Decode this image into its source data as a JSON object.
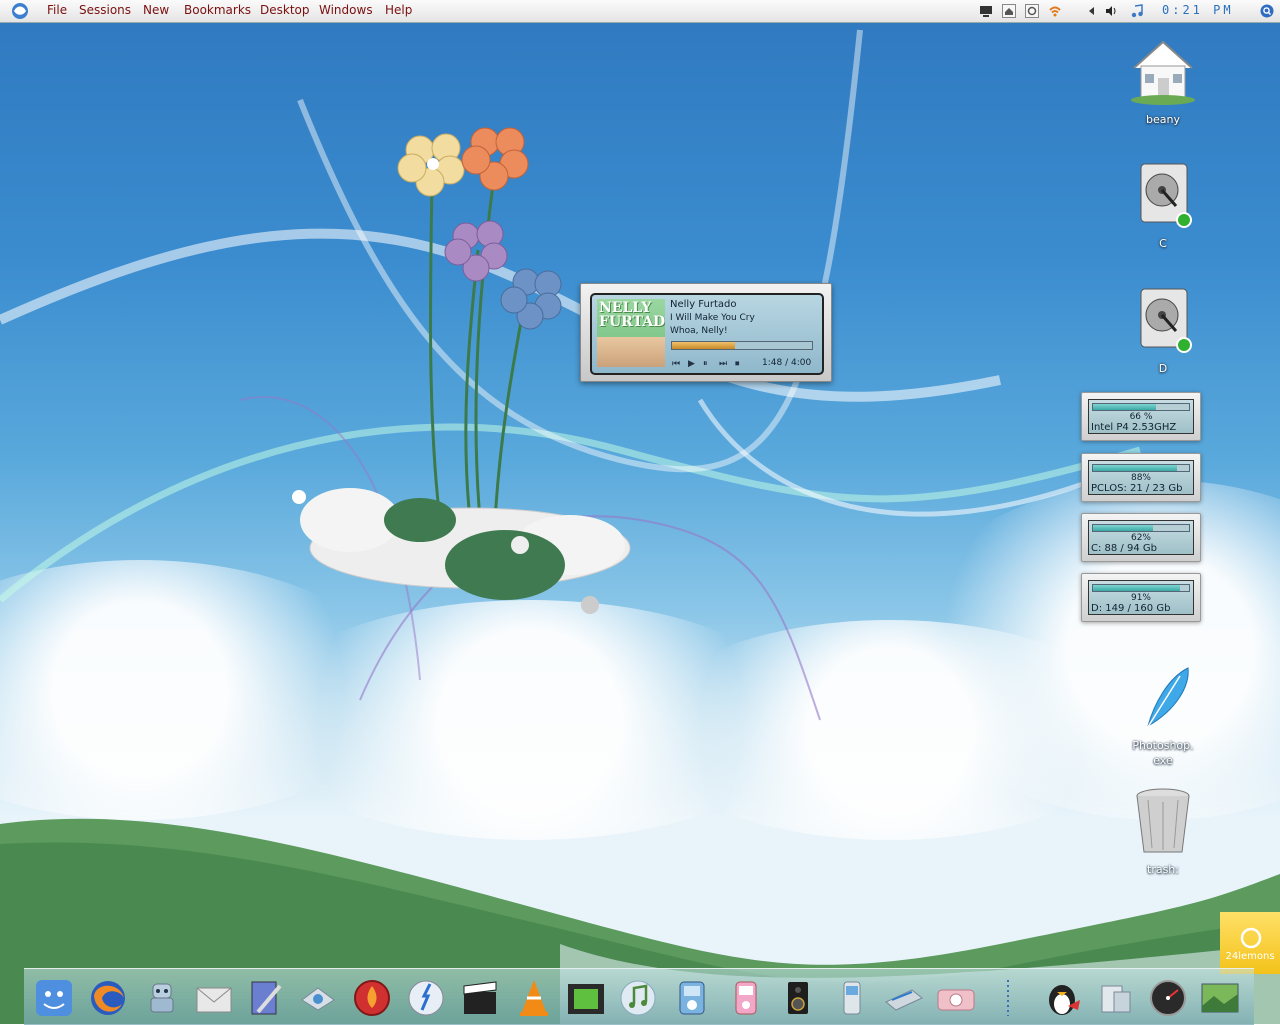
{
  "menubar": {
    "menus": [
      "File",
      "Sessions",
      "New",
      "Bookmarks",
      "Desktop",
      "Windows",
      "Help"
    ],
    "clock": "0:21 PM",
    "tray_icons": [
      "monitor-icon",
      "home-icon",
      "refresh-icon",
      "wifi-icon",
      "arrow-left-icon",
      "volume-icon",
      "music-note-icon",
      "search-icon"
    ]
  },
  "desktop_icons": [
    {
      "label": "beany",
      "icon": "home-folder-icon"
    },
    {
      "label": "C",
      "icon": "hard-drive-icon"
    },
    {
      "label": "D",
      "icon": "hard-drive-icon"
    },
    {
      "label": "Photoshop.\nexe",
      "icon": "feather-icon"
    },
    {
      "label": "trash:",
      "icon": "trash-icon"
    }
  ],
  "player": {
    "cover_text": "NELLY FURTADO",
    "artist": "Nelly Furtado",
    "track": "I Will Make You Cry",
    "album": "Whoa, Nelly!",
    "time": "1:48 / 4:00",
    "progress": 0.45,
    "controls": [
      "⏮",
      "▶",
      "⏸",
      "⏭",
      "⏹"
    ]
  },
  "monitors": [
    {
      "pct": "66 %",
      "text": "Intel P4 2.53GHZ",
      "fill": 0.66
    },
    {
      "pct": "88%",
      "text": "PCLOS: 21 / 23 Gb",
      "fill": 0.88
    },
    {
      "pct": "62%",
      "text": "C: 88 / 94 Gb",
      "fill": 0.62
    },
    {
      "pct": "91%",
      "text": "D: 149 / 160 Gb",
      "fill": 0.91
    }
  ],
  "lemons_text": "24lemons",
  "dock": [
    "finder-icon",
    "firefox-icon",
    "robot-icon",
    "mail-icon",
    "editor-icon",
    "network-icon",
    "burn-icon",
    "dashboard-icon",
    "clapper-icon",
    "vlc-icon",
    "video-icon",
    "itunes-icon",
    "ipod-icon",
    "ipod-pink-icon",
    "speaker-icon",
    "phone-icon",
    "scanner-icon",
    "camera-icon",
    "separator",
    "tux-icon",
    "system-icon",
    "gauge-icon",
    "photos-icon"
  ],
  "colors": {
    "menu_text": "#7a1010",
    "clock": "#2a6fc0",
    "accent": "#3aa9a6"
  }
}
